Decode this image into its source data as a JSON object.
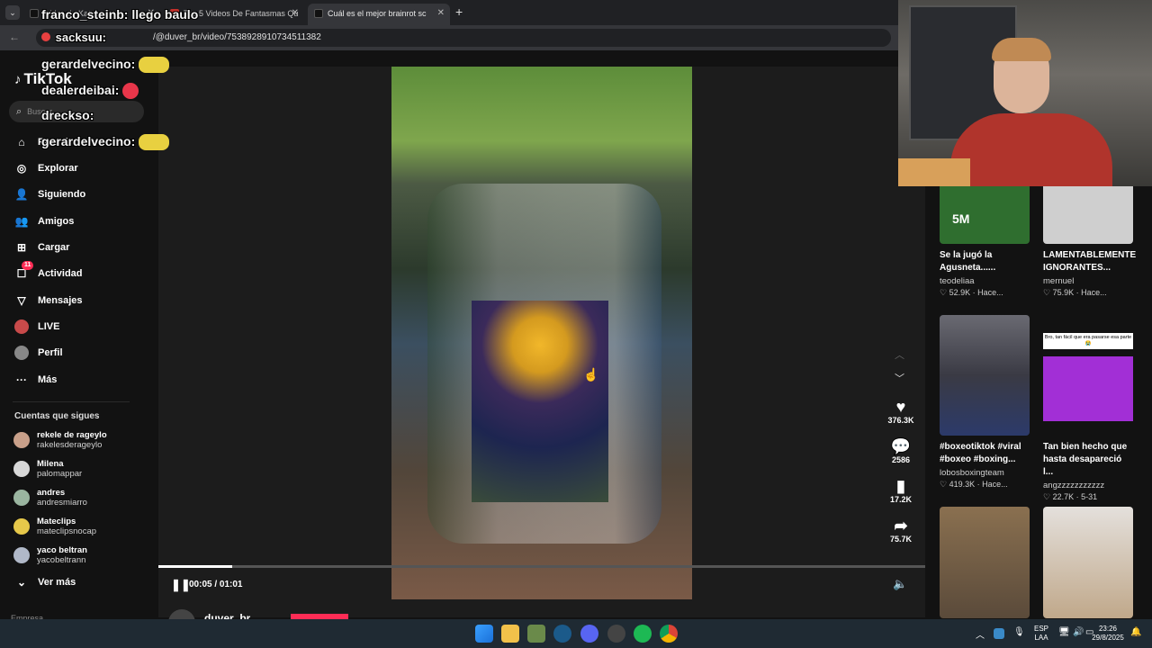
{
  "browser": {
    "tabs": [
      {
        "label": "...idos de Kate..."
      },
      {
        "label": "Top 5 Videos De Fantasmas Qu"
      },
      {
        "label": "Cuál es el mejor brainrot sc"
      }
    ],
    "add_tab": "+",
    "url": "/@duver_br/video/7538928910734511382"
  },
  "chat": [
    {
      "user": "franco_steinb:",
      "msg": "llego baulo"
    },
    {
      "user": "sacksuu:",
      "msg": ""
    },
    {
      "user": "gerardelvecino:",
      "msg": ""
    },
    {
      "user": "dealerdeibai:",
      "msg": ""
    },
    {
      "user": "drecksо:",
      "msg": ""
    },
    {
      "user": "gerardelvecino:",
      "msg": ""
    }
  ],
  "sidebar": {
    "logo": "TikTok",
    "search_placeholder": "Buscar",
    "nav": [
      {
        "label": "Para ti",
        "icon": "home-icon"
      },
      {
        "label": "Explorar",
        "icon": "compass-icon"
      },
      {
        "label": "Siguiendo",
        "icon": "following-icon"
      },
      {
        "label": "Amigos",
        "icon": "friends-icon"
      },
      {
        "label": "Cargar",
        "icon": "upload-icon"
      },
      {
        "label": "Actividad",
        "icon": "inbox-icon",
        "badge": "11"
      },
      {
        "label": "Mensajes",
        "icon": "send-icon"
      },
      {
        "label": "LIVE",
        "icon": "live-icon"
      },
      {
        "label": "Perfil",
        "icon": "profile-icon"
      },
      {
        "label": "Más",
        "icon": "more-icon"
      }
    ],
    "following_heading": "Cuentas que sigues",
    "following": [
      {
        "name": "rekele de rageylo",
        "handle": "rakelesderageylo",
        "color": "#c9a08a"
      },
      {
        "name": "Milena",
        "handle": "palomappar",
        "color": "#d8d8d8"
      },
      {
        "name": "andres",
        "handle": "andresmiarro",
        "color": "#9ab5a0"
      },
      {
        "name": "Mateclips",
        "handle": "mateclipsnocap",
        "color": "#e6c84a"
      },
      {
        "name": "yaco beltran",
        "handle": "yacobeltrann",
        "color": "#b0b8c8"
      }
    ],
    "see_more": "Ver más",
    "footer_partial": "Empresa"
  },
  "player": {
    "time": "00:05 / 01:01",
    "progress_fraction": 0.083,
    "author_partial": "duver_br"
  },
  "actions": [
    {
      "icon": "heart-icon",
      "count": "376.3K"
    },
    {
      "icon": "comment-icon",
      "count": "2586"
    },
    {
      "icon": "bookmark-icon",
      "count": "17.2K"
    },
    {
      "icon": "share-icon",
      "count": "75.7K"
    }
  ],
  "related": [
    {
      "title": "Se la jugó la Agusneta......",
      "author": "teodeliaa",
      "likes": "52.9K",
      "date": "Hace...",
      "color": "#3a7a3a"
    },
    {
      "title": "LAMENTABLEMENTE IGNORANTES...",
      "author": "mernuel",
      "likes": "75.9K",
      "date": "Hace...",
      "color": "#c8c8c8"
    },
    {
      "title": "#boxeotiktok #viral #boxeo #boxing...",
      "author": "lobosboxingteam",
      "likes": "419.3K",
      "date": "Hace...",
      "color": "#5a5a66"
    },
    {
      "title": "Tan bien hecho que hasta desapareció l...",
      "author": "angzzzzzzzzzzz",
      "likes": "22.7K",
      "date": "5-31",
      "color": "#9a2fd0"
    },
    {
      "title": "",
      "author": "",
      "likes": "",
      "date": "",
      "color": "#7a6a5a"
    },
    {
      "title": "",
      "author": "",
      "likes": "",
      "date": "",
      "color": "#d8d2cc"
    }
  ],
  "related_overlay_4": "Bro, tan fácil que era pasarse esa parte 😭",
  "related_overlay_1": "5M",
  "tray": {
    "lang1": "ESP",
    "lang2": "LAA",
    "time": "23:26",
    "date": "29/8/2025"
  }
}
